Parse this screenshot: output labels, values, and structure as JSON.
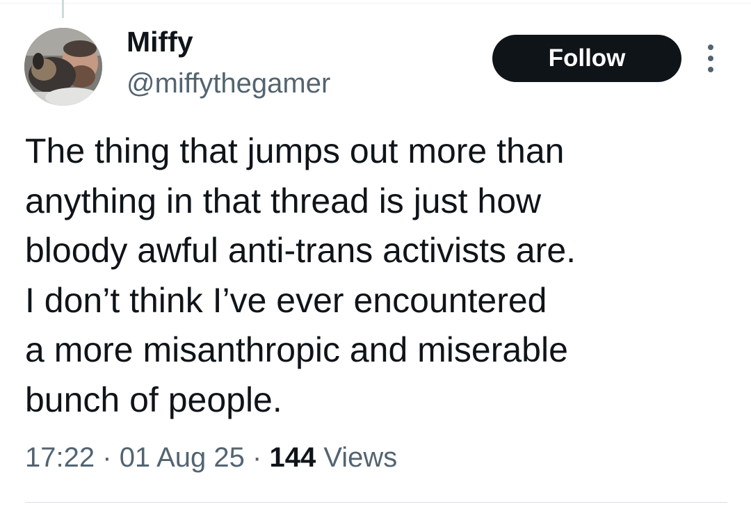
{
  "author": {
    "display_name": "Miffy",
    "handle": "@miffythegamer"
  },
  "follow_label": "Follow",
  "more_icon": "more-vertical-icon",
  "tweet": {
    "text": "The thing that jumps out more than\nanything in that thread is just how\nbloody awful anti-trans activists are.\nI don’t think I’ve ever encountered\na more misanthropic and miserable\nbunch of people."
  },
  "meta": {
    "time": "17:22",
    "separator": "·",
    "date": "01 Aug 25",
    "views_count": "144",
    "views_label": "Views"
  },
  "colors": {
    "text_primary": "#0f1419",
    "text_secondary": "#536471",
    "button_bg": "#0f1419",
    "divider": "#eff3f4"
  }
}
